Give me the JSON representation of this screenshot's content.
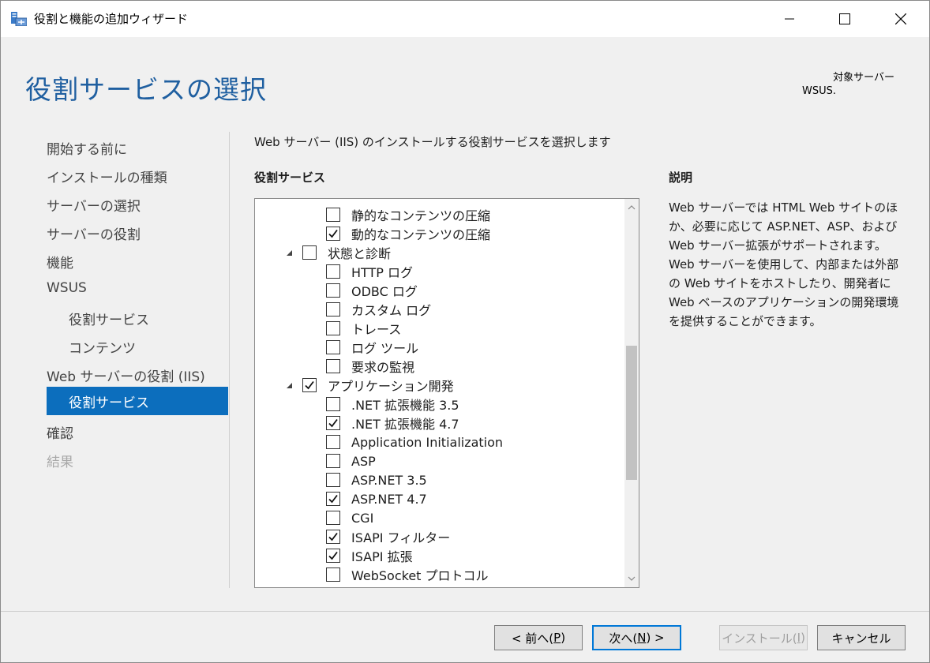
{
  "window": {
    "title": "役割と機能の追加ウィザード"
  },
  "header": {
    "page_title": "役割サービスの選択",
    "target_label": "対象サーバー",
    "target_value": "WSUS."
  },
  "nav": {
    "items": [
      {
        "label": "開始する前に",
        "state": "normal"
      },
      {
        "label": "インストールの種類",
        "state": "normal"
      },
      {
        "label": "サーバーの選択",
        "state": "normal"
      },
      {
        "label": "サーバーの役割",
        "state": "normal"
      },
      {
        "label": "機能",
        "state": "normal"
      },
      {
        "label": "WSUS",
        "state": "normal"
      },
      {
        "label": "役割サービス",
        "state": "sub"
      },
      {
        "label": "コンテンツ",
        "state": "sub"
      },
      {
        "label": "Web サーバーの役割 (IIS)",
        "state": "normal"
      },
      {
        "label": "役割サービス",
        "state": "active"
      },
      {
        "label": "確認",
        "state": "normal"
      },
      {
        "label": "結果",
        "state": "disabled"
      }
    ]
  },
  "content": {
    "instruction": "Web サーバー (IIS) のインストールする役割サービスを選択します",
    "services_label": "役割サービス",
    "description_label": "説明",
    "description_text": "Web サーバーでは HTML Web サイトのほか、必要に応じて ASP.NET、ASP、および Web サーバー拡張がサポートされます。Web サーバーを使用して、内部または外部の Web サイトをホストしたり、開発者に Web ベースのアプリケーションの開発環境を提供することができます。"
  },
  "services": [
    {
      "label": "静的なコンテンツの圧縮",
      "checked": false,
      "level": 2,
      "expander": false
    },
    {
      "label": "動的なコンテンツの圧縮",
      "checked": true,
      "level": 2,
      "expander": false
    },
    {
      "label": "状態と診断",
      "checked": false,
      "level": 1,
      "expander": true
    },
    {
      "label": "HTTP ログ",
      "checked": false,
      "level": 2,
      "expander": false
    },
    {
      "label": "ODBC ログ",
      "checked": false,
      "level": 2,
      "expander": false
    },
    {
      "label": "カスタム ログ",
      "checked": false,
      "level": 2,
      "expander": false
    },
    {
      "label": "トレース",
      "checked": false,
      "level": 2,
      "expander": false
    },
    {
      "label": "ログ ツール",
      "checked": false,
      "level": 2,
      "expander": false
    },
    {
      "label": "要求の監視",
      "checked": false,
      "level": 2,
      "expander": false
    },
    {
      "label": "アプリケーション開発",
      "checked": true,
      "level": 1,
      "expander": true
    },
    {
      "label": ".NET 拡張機能 3.5",
      "checked": false,
      "level": 2,
      "expander": false
    },
    {
      "label": ".NET 拡張機能 4.7",
      "checked": true,
      "level": 2,
      "expander": false
    },
    {
      "label": "Application Initialization",
      "checked": false,
      "level": 2,
      "expander": false
    },
    {
      "label": "ASP",
      "checked": false,
      "level": 2,
      "expander": false
    },
    {
      "label": "ASP.NET 3.5",
      "checked": false,
      "level": 2,
      "expander": false
    },
    {
      "label": "ASP.NET 4.7",
      "checked": true,
      "level": 2,
      "expander": false
    },
    {
      "label": "CGI",
      "checked": false,
      "level": 2,
      "expander": false
    },
    {
      "label": "ISAPI フィルター",
      "checked": true,
      "level": 2,
      "expander": false
    },
    {
      "label": "ISAPI 拡張",
      "checked": true,
      "level": 2,
      "expander": false
    },
    {
      "label": "WebSocket プロトコル",
      "checked": false,
      "level": 2,
      "expander": false
    }
  ],
  "buttons": {
    "prev_label": "< 前へ(",
    "prev_key": "P",
    "prev_tail": ")",
    "next_label": "次へ(",
    "next_key": "N",
    "next_tail": ") >",
    "install_label": "インストール(",
    "install_key": "I",
    "install_tail": ")",
    "cancel_label": "キャンセル"
  }
}
